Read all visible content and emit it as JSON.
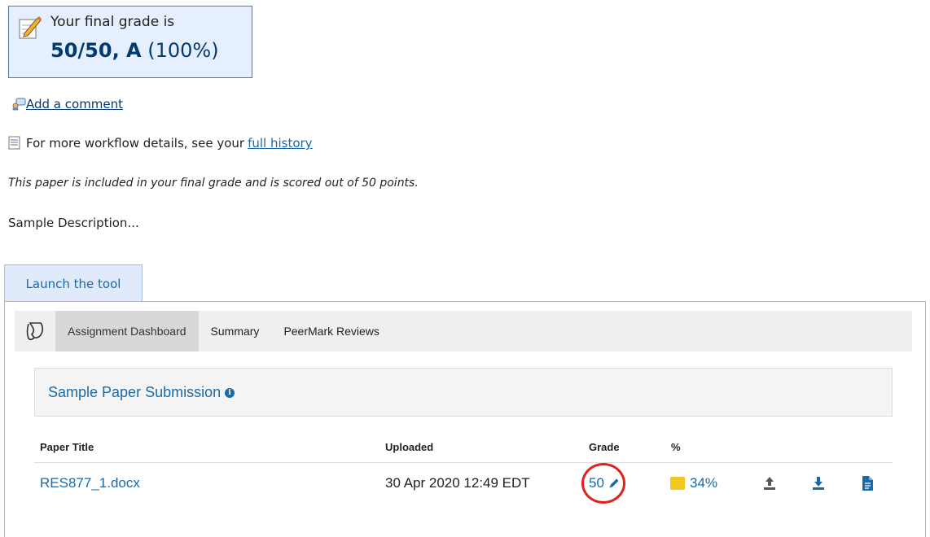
{
  "grade_box": {
    "intro": "Your final grade is",
    "score": "50/50, A",
    "percent": "(100%)"
  },
  "comment_link": "Add a comment",
  "history": {
    "text": "For more workflow details, see your",
    "link": "full history"
  },
  "paper_note": "This paper is included in your final grade and is scored out of 50 points.",
  "description": "Sample Description...",
  "launch_tab": "Launch the tool",
  "tool": {
    "nav": [
      "Assignment Dashboard",
      "Summary",
      "PeerMark Reviews"
    ],
    "panel_title": "Sample Paper Submission",
    "table": {
      "headers": {
        "title": "Paper Title",
        "uploaded": "Uploaded",
        "grade": "Grade",
        "percent": "%"
      },
      "row": {
        "title": "RES877_1.docx",
        "uploaded": "30 Apr 2020 12:49 EDT",
        "grade": "50",
        "similarity": "34%"
      }
    },
    "colors": {
      "link": "#1a6aa8",
      "similarity_swatch": "#f2c81d",
      "highlight_ring": "#e0221b"
    },
    "icons": [
      "upload-icon",
      "download-icon",
      "document-icon"
    ]
  }
}
